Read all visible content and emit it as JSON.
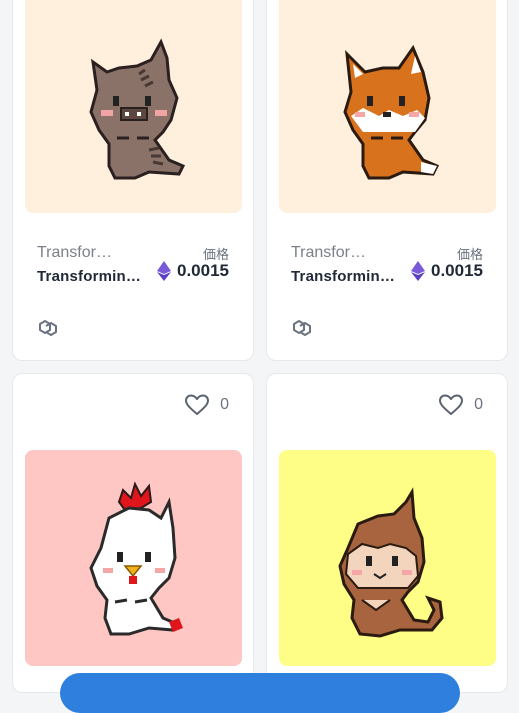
{
  "price_label": "価格",
  "cards": [
    {
      "image_bg": "#fef0dd",
      "collection": "Transfor…",
      "name": "Transformin…",
      "price": "0.0015",
      "currency_icon": "ethereum-icon",
      "chain_icon": "polygon-icon",
      "character": "boar"
    },
    {
      "image_bg": "#fef0dd",
      "collection": "Transfor…",
      "name": "Transformin…",
      "price": "0.0015",
      "currency_icon": "ethereum-icon",
      "chain_icon": "polygon-icon",
      "character": "fox"
    },
    {
      "image_bg": "#fec7c3",
      "likes": "0",
      "like_icon": "heart-icon",
      "character": "rooster"
    },
    {
      "image_bg": "#fefd85",
      "likes": "0",
      "like_icon": "heart-icon",
      "character": "monkey"
    }
  ],
  "colors": {
    "accent": "#2f7fde",
    "eth": "#6d4fd6"
  }
}
